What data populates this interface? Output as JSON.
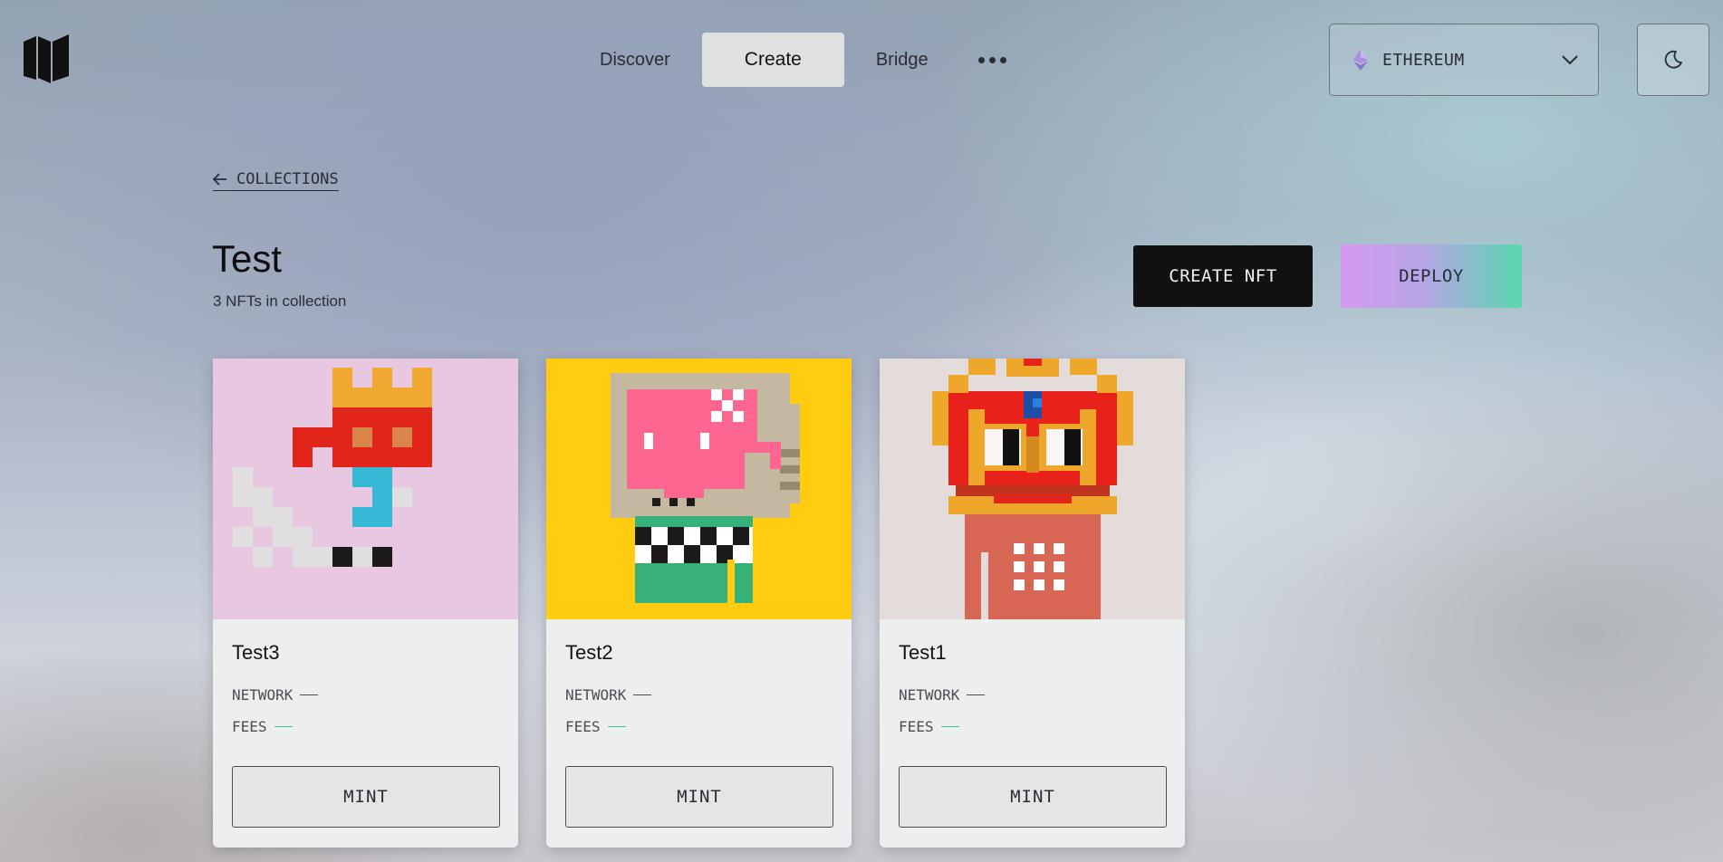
{
  "header": {
    "logo": "brand-logo",
    "nav": [
      {
        "label": "Discover",
        "active": false
      },
      {
        "label": "Create",
        "active": true
      },
      {
        "label": "Bridge",
        "active": false
      }
    ],
    "more_icon": "more-horizontal-icon",
    "network_select": {
      "value": "ETHEREUM",
      "icon": "ethereum-icon"
    },
    "theme_icon": "moon-icon"
  },
  "page": {
    "back_label": "COLLECTIONS",
    "title": "Test",
    "subtitle": "3 NFTs in collection",
    "create_label": "CREATE NFT",
    "deploy_label": "DEPLOY"
  },
  "colors": {
    "card_bg": "#edefee",
    "deploy_gradient_start": "#d59af0",
    "deploy_gradient_end": "#58d8ae",
    "fees_accent": "#3cc29b"
  },
  "cards": [
    {
      "name": "Test3",
      "network_label": "NETWORK",
      "fees_label": "FEES",
      "mint_label": "MINT",
      "art_bg": "#e8c8e0"
    },
    {
      "name": "Test2",
      "network_label": "NETWORK",
      "fees_label": "FEES",
      "mint_label": "MINT",
      "art_bg": "#ffcc0f"
    },
    {
      "name": "Test1",
      "network_label": "NETWORK",
      "fees_label": "FEES",
      "mint_label": "MINT",
      "art_bg": "#e3dcda"
    }
  ]
}
